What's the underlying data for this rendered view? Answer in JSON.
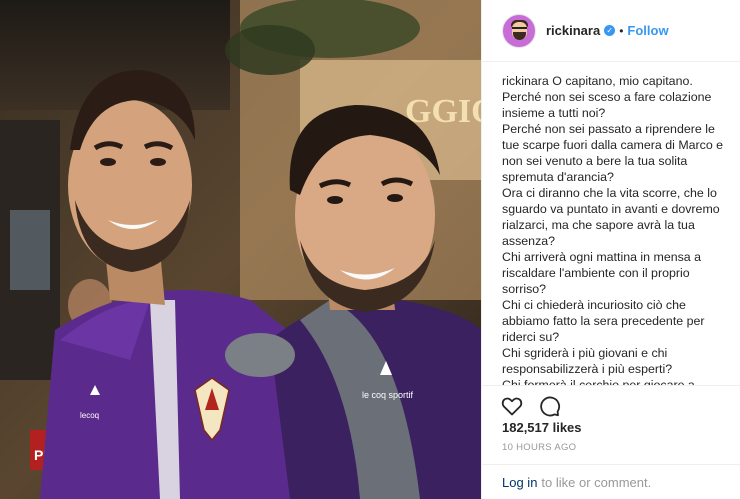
{
  "photo": {
    "description_icon": "photo",
    "sign_text": "GGIO",
    "shirt_brand": "le coq sportif",
    "shirt_brand_short": "lecoq",
    "crest_letters": "A C F",
    "background_sign": "PI",
    "kit_color": "#5a2b8c"
  },
  "post": {
    "username": "rickinara",
    "verified_icon": "verified-badge-icon",
    "follow_label": "Follow",
    "separator": "•",
    "caption_user": "rickinara",
    "caption_lines": [
      "O capitano, mio capitano.",
      "Perché non sei sceso a fare colazione insieme a tutti noi?",
      "Perché non sei passato a riprendere le tue scarpe fuori dalla camera di Marco e non sei venuto a bere la tua solita spremuta d'arancia?",
      "Ora ci diranno che la vita scorre, che lo sguardo va puntato in avanti e dovremo rialzarci, ma che sapore avrà la tua assenza?",
      "Chi arriverà ogni mattina in mensa a riscaldare l'ambiente con il proprio sorriso?",
      "Chi ci chiederà incuriosito ciò che abbiamo fatto la sera precedente per riderci su?",
      "Chi sgriderà i più giovani e chi responsabilizzerà i più esperti?",
      "Chi formerà il cerchio per giocare a \"battro\" nelle dita la mattina? Ma"
    ],
    "likes": "182,517 likes",
    "time_ago": "10 HOURS AGO",
    "login_label": "Log in",
    "login_suffix": "to like or comment."
  },
  "colors": {
    "link_blue": "#3897f0",
    "login_blue": "#003569",
    "muted_gray": "#999999",
    "avatar_bg": "#c86dd7"
  }
}
